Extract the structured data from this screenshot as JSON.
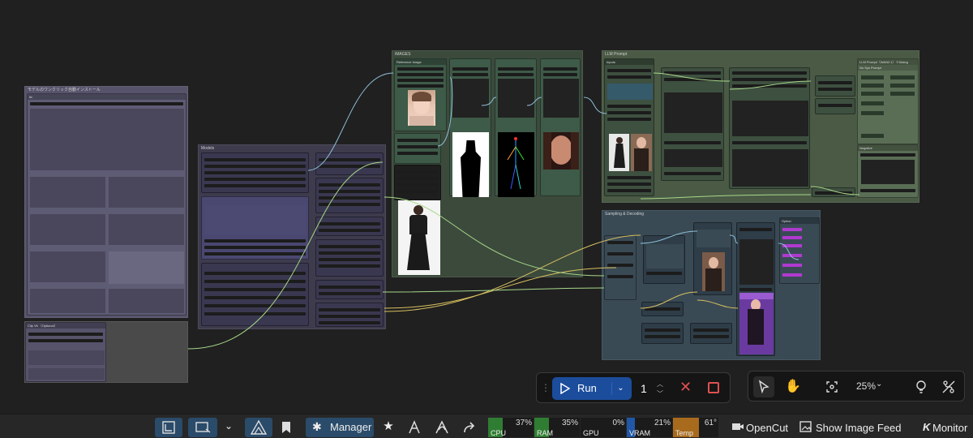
{
  "canvas": {
    "groups": {
      "model_install": "モデルのワンクリック自動インストール",
      "model_install_sub": "ltx",
      "clip_vit": "Clip Vit （Optional）",
      "models": "Models",
      "images": "IMAGES",
      "images_sub1": "Reference Image",
      "llm_prompt": "LLM Prompt",
      "llm_prompt_node": "LLM Prompt（WAN2.1）＋Dialog",
      "no_sys_prompt": "No Sys Prompt",
      "negative": "Negative",
      "sampling": "Sampling & Decoding",
      "option": "Option",
      "inputs": "Inputs"
    }
  },
  "run_toolbar": {
    "run_label": "Run",
    "batch_count": "1"
  },
  "tools_toolbar": {
    "zoom": "25%"
  },
  "taskbar": {
    "manager_label": "Manager",
    "meters": [
      {
        "name": "CPU",
        "value": "37%",
        "color": "#2f7d32"
      },
      {
        "name": "RAM",
        "value": "35%",
        "color": "#2f7d32"
      },
      {
        "name": "GPU",
        "value": "0%",
        "color": "#2f7d32"
      },
      {
        "name": "VRAM",
        "value": "21%",
        "color": "#2157a8"
      },
      {
        "name": "Temp",
        "value": "61°",
        "color": "#a86a1c"
      }
    ],
    "opencut_label": "OpenCut",
    "image_feed_label": "Show Image Feed",
    "monitor_label": "Monitor"
  }
}
